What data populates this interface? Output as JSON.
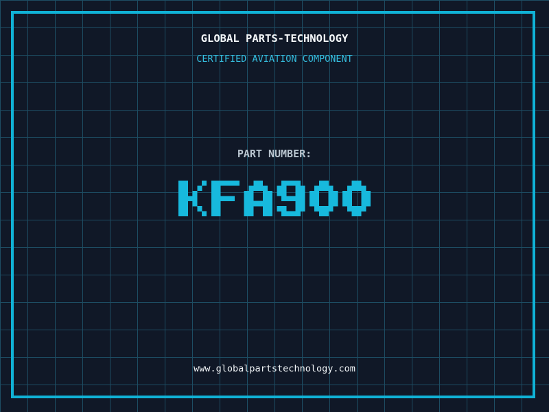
{
  "header": {
    "title": "GLOBAL PARTS-TECHNOLOGY",
    "subtitle": "CERTIFIED AVIATION COMPONENT"
  },
  "part": {
    "label": "PART NUMBER:",
    "value": "KFA900"
  },
  "footer": {
    "url": "www.globalpartstechnology.com"
  },
  "colors": {
    "background": "#101827",
    "grid_line": "#1d4d63",
    "frame": "#10b2d6",
    "title_text": "#f3f6f8",
    "subtitle_text": "#35bfe0",
    "label_text": "#b8c4ce",
    "part_number_text": "#17b9dd",
    "url_text": "#f0f4f6"
  }
}
